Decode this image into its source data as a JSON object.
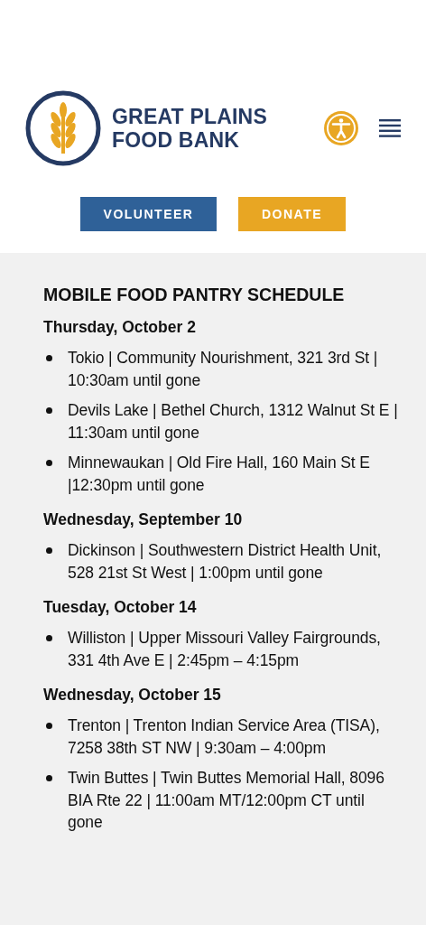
{
  "header": {
    "logo_lines": [
      "GREAT PLAINS",
      "FOOD BANK"
    ],
    "buttons": [
      {
        "label": "VOLUNTEER",
        "kind": "primary"
      },
      {
        "label": "DONATE",
        "kind": "accent"
      }
    ]
  },
  "schedule": {
    "title": "MOBILE FOOD PANTRY SCHEDULE",
    "days": [
      {
        "date": "Thursday, October 2",
        "items": [
          "Tokio | Community Nourishment, 321 3rd St | 10:30am until gone",
          "Devils Lake | Bethel Church, 1312 Walnut St E | 11:30am until gone",
          "Minnewaukan | Old Fire Hall, 160 Main St E |12:30pm until gone"
        ]
      },
      {
        "date": "Wednesday, September 10",
        "items": [
          "Dickinson | Southwestern District Health Unit, 528 21st St West | 1:00pm until gone"
        ]
      },
      {
        "date": "Tuesday, October 14",
        "items": [
          "Williston | Upper Missouri Valley Fairgrounds, 331 4th Ave E | 2:45pm – 4:15pm"
        ]
      },
      {
        "date": "Wednesday, October 15",
        "items": [
          "Trenton | Trenton Indian Service Area (TISA), 7258 38th ST NW | 9:30am – 4:00pm",
          "Twin Buttes | Twin Buttes Memorial Hall, 8096 BIA Rte 22 | 11:00am MT/12:00pm CT until gone"
        ]
      }
    ]
  }
}
